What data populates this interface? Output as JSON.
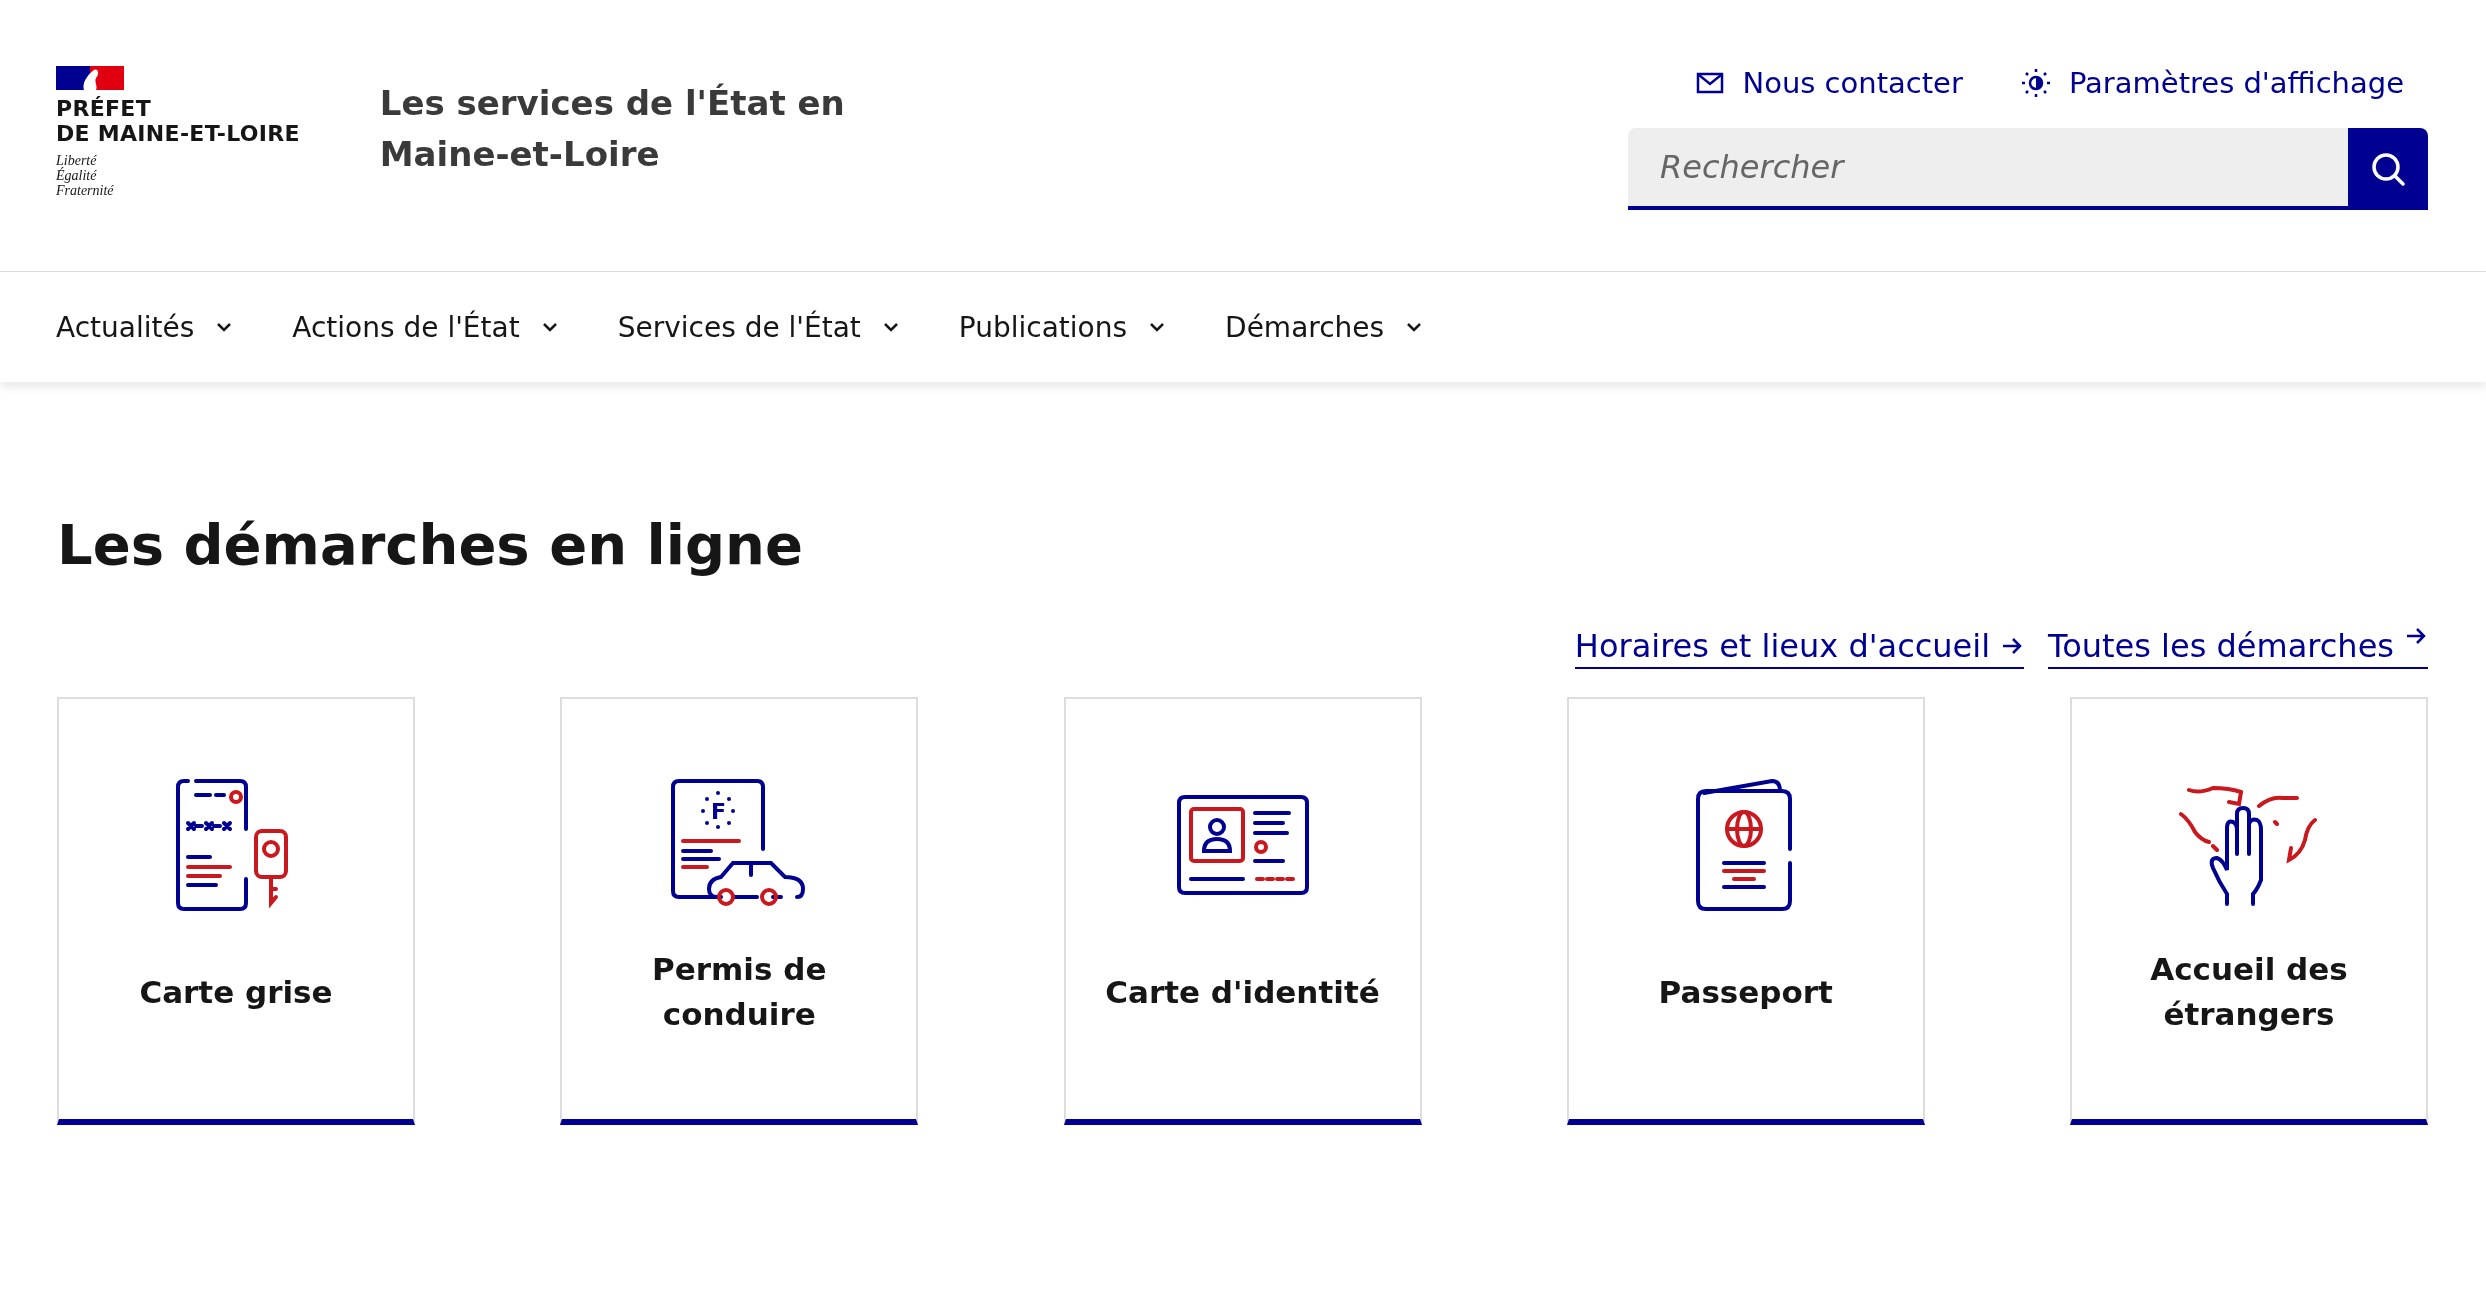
{
  "logo": {
    "title": "PRÉFET\nDE MAINE-ET-LOIRE",
    "motto": [
      "Liberté",
      "Égalité",
      "Fraternité"
    ]
  },
  "site_title": "Les services de l'État en Maine-et-Loire",
  "header_links": [
    {
      "label": "Nous contacter",
      "kind": "mail"
    },
    {
      "label": "Paramètres d'affichage",
      "kind": "display"
    }
  ],
  "search": {
    "placeholder": "Rechercher"
  },
  "nav": [
    {
      "label": "Actualités"
    },
    {
      "label": "Actions de l'État"
    },
    {
      "label": "Services de l'État"
    },
    {
      "label": "Publications"
    },
    {
      "label": "Démarches"
    }
  ],
  "heading": "Les démarches en ligne",
  "links": [
    "Horaires et lieux d'accueil",
    "Toutes les démarches"
  ],
  "cards": [
    {
      "label": "Carte grise",
      "kind": "registration"
    },
    {
      "label": "Permis de conduire",
      "kind": "license",
      "icon_letter": "F"
    },
    {
      "label": "Carte d'identité",
      "kind": "id"
    },
    {
      "label": "Passeport",
      "kind": "passport"
    },
    {
      "label": "Accueil des étrangers",
      "kind": "foreigners"
    }
  ]
}
